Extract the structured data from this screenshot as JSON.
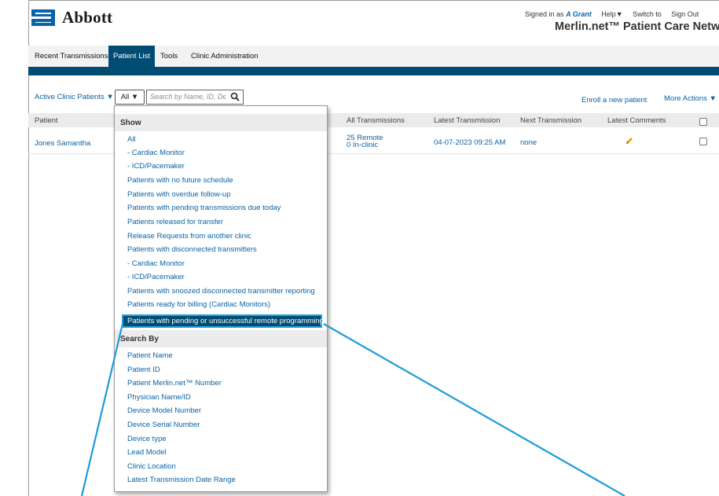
{
  "brand": {
    "name": "Abbott",
    "logo_color": "#0a63a6"
  },
  "userbar": {
    "signed_in_prefix": "Signed in as",
    "user": "A Grant",
    "help": "Help▼",
    "switch": "Switch to",
    "sign_out": "Sign Out"
  },
  "network_title": "Merlin.net™ Patient Care Network",
  "tabs": [
    {
      "label": "Recent Transmissions"
    },
    {
      "label": "Patient List",
      "active": true
    },
    {
      "label": "Tools"
    },
    {
      "label": "Clinic Administration"
    }
  ],
  "toolbar": {
    "filter_label": "Active Clinic Patients  ▼",
    "filter_select": "All ▼",
    "search_placeholder": "Search by Name, ID, Device",
    "enroll_link": "Enroll a new patient",
    "more_actions": "More Actions ▼"
  },
  "table": {
    "columns": [
      "Patient",
      "All Transmissions",
      "Latest Transmission",
      "Next Transmission",
      "Latest Comments"
    ],
    "rows": [
      {
        "patient": "Jones Samantha",
        "transmissions_remote": "25 Remote",
        "transmissions_clinic": "0 In-clinic",
        "latest": "04-07-2023 09:25 AM",
        "next": "none"
      }
    ]
  },
  "dropdown": {
    "show_header": "Show",
    "show_items": [
      "All",
      "- Cardiac Monitor",
      "- ICD/Pacemaker",
      "Patients with no future schedule",
      "Patients with overdue follow-up",
      "Patients with pending transmissions due today",
      "Patients released for transfer",
      "Release Requests from another clinic",
      "Patients with disconnected transmitters",
      "- Cardiac Monitor",
      "- ICD/Pacemaker",
      "Patients with snoozed disconnected transmitter reporting",
      "Patients ready for billing (Cardiac Monitors)"
    ],
    "highlighted_item": "Patients with pending or unsuccessful remote programming",
    "search_header": "Search By",
    "search_items": [
      "Patient Name",
      "Patient ID",
      "Patient Merlin.net™ Number",
      "Physician Name/ID",
      "Device Model Number",
      "Device Serial Number",
      "Device type",
      "Lead Model",
      "Clinic Location",
      "Latest Transmission Date Range"
    ]
  },
  "colors": {
    "accent": "#004c73",
    "link": "#0a63a6",
    "callout": "#1e9bd7",
    "comment_pencil": "#e8a317"
  }
}
